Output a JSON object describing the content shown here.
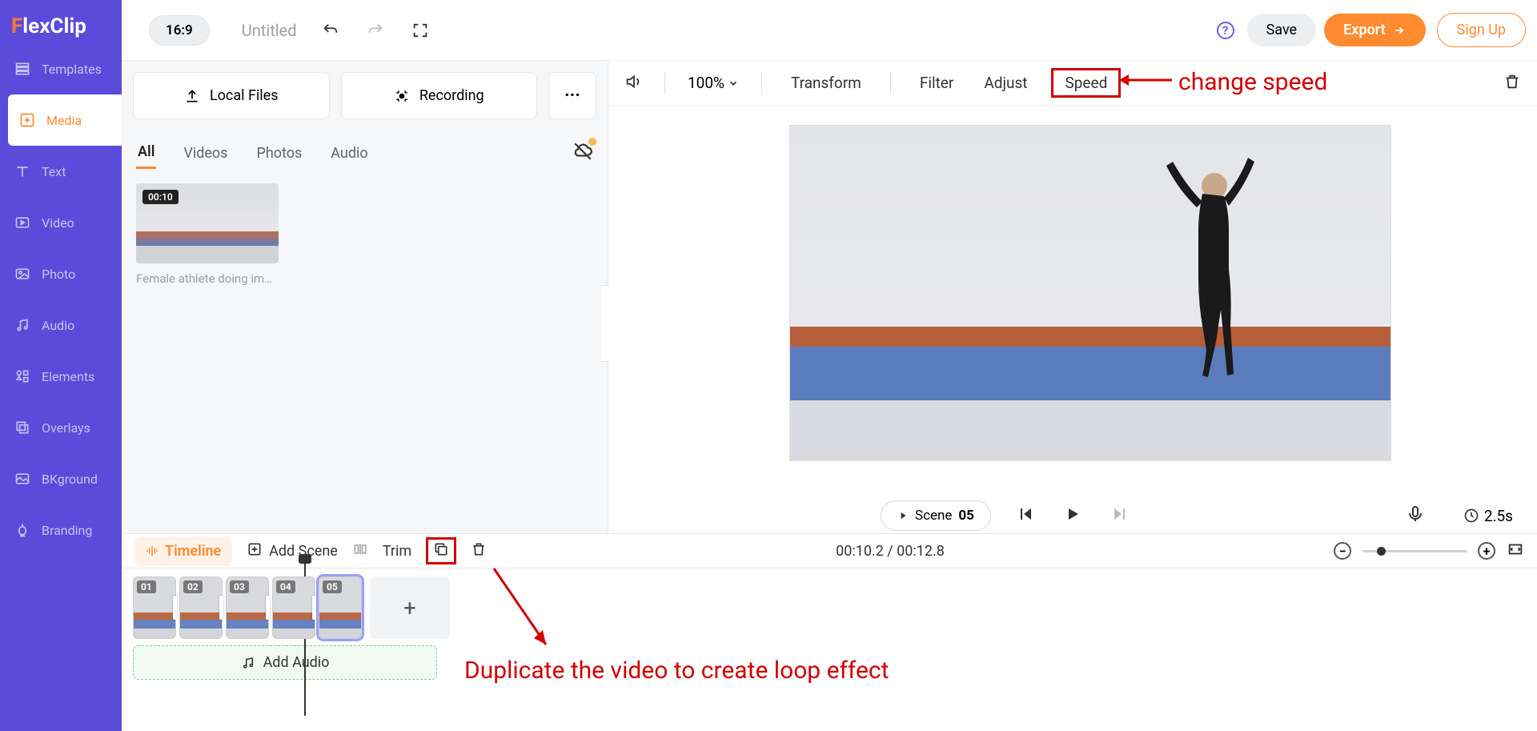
{
  "logo": {
    "f": "F",
    "rest": "lexClip"
  },
  "sidebar": {
    "items": [
      {
        "label": "Templates"
      },
      {
        "label": "Media"
      },
      {
        "label": "Text"
      },
      {
        "label": "Video"
      },
      {
        "label": "Photo"
      },
      {
        "label": "Audio"
      },
      {
        "label": "Elements"
      },
      {
        "label": "Overlays"
      },
      {
        "label": "BKground"
      },
      {
        "label": "Branding"
      }
    ]
  },
  "topbar": {
    "ratio": "16:9",
    "title": "Untitled",
    "save": "Save",
    "export": "Export",
    "signup": "Sign Up"
  },
  "media": {
    "local": "Local Files",
    "recording": "Recording",
    "tabs": {
      "all": "All",
      "videos": "Videos",
      "photos": "Photos",
      "audio": "Audio"
    },
    "thumb_dur": "00:10",
    "thumb_caption": "Female athlete doing im…"
  },
  "preview_toolbar": {
    "zoom": "100%",
    "transform": "Transform",
    "filter": "Filter",
    "adjust": "Adjust",
    "speed": "Speed"
  },
  "preview": {
    "scene_label": "Scene",
    "scene_num": "05",
    "duration": "2.5s"
  },
  "timeline_bar": {
    "timeline": "Timeline",
    "add_scene": "Add Scene",
    "trim": "Trim",
    "time": "00:10.2 / 00:12.8"
  },
  "scenes": [
    "01",
    "02",
    "03",
    "04",
    "05"
  ],
  "audio_track": {
    "label": "Add Audio"
  },
  "annotations": {
    "speed": "change speed",
    "duplicate": "Duplicate the video to create loop effect"
  }
}
